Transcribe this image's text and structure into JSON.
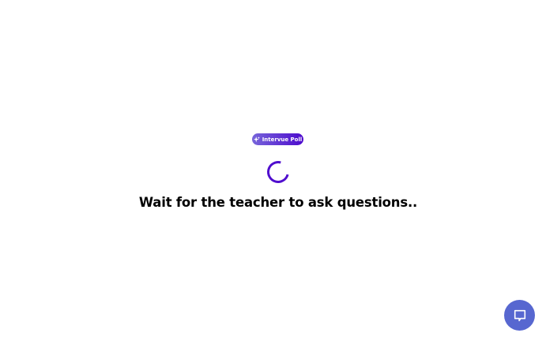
{
  "badge": {
    "label": "Intervue Poll",
    "icon": "sparkle-icon"
  },
  "status": {
    "message": "Wait for the teacher to ask questions.."
  },
  "chat_button": {
    "icon": "chat-bubble-icon"
  },
  "colors": {
    "accent": "#500ECE",
    "badge_start": "#7765DA",
    "badge_end": "#4D0ACD",
    "chat_button": "#5767D0"
  }
}
